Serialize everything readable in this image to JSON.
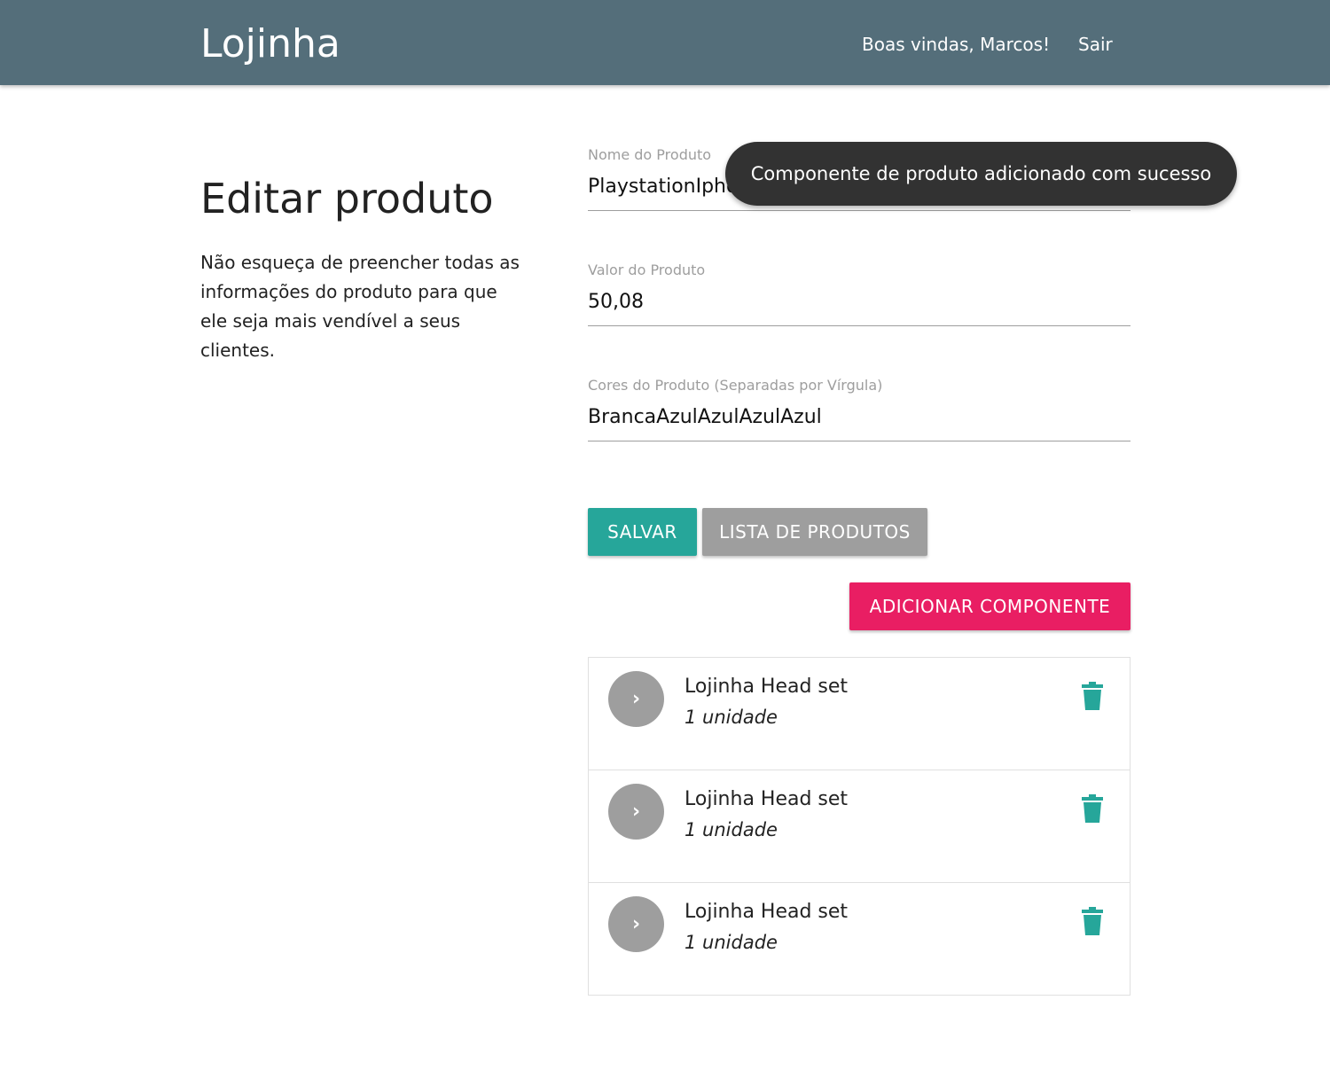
{
  "navbar": {
    "brand": "Lojinha",
    "greeting": "Boas vindas, Marcos!",
    "logout_label": "Sair"
  },
  "page": {
    "title": "Editar produto",
    "description": "Não esqueça de preencher todas as informações do produto para que ele seja mais vendível a seus clientes."
  },
  "form": {
    "name_label": "Nome do Produto",
    "name_value": "PlaystationIphone",
    "price_label": "Valor do Produto",
    "price_value": "50,08",
    "colors_label": "Cores do Produto (Separadas por Vírgula)",
    "colors_value": "BrancaAzulAzulAzulAzul"
  },
  "actions": {
    "save_label": "SALVAR",
    "list_label": "LISTA DE PRODUTOS",
    "add_component_label": "ADICIONAR COMPONENTE"
  },
  "components": [
    {
      "name": "Lojinha Head set",
      "quantity": "1 unidade"
    },
    {
      "name": "Lojinha Head set",
      "quantity": "1 unidade"
    },
    {
      "name": "Lojinha Head set",
      "quantity": "1 unidade"
    }
  ],
  "toast": {
    "message": "Componente de produto adicionado com sucesso"
  },
  "colors": {
    "navbar": "#546e7a",
    "primary": "#26a69a",
    "secondary": "#9e9e9e",
    "accent": "#e91e63",
    "toast": "#323232"
  },
  "icons": {
    "avatar": "chevron-right-icon",
    "delete": "trash-icon"
  }
}
